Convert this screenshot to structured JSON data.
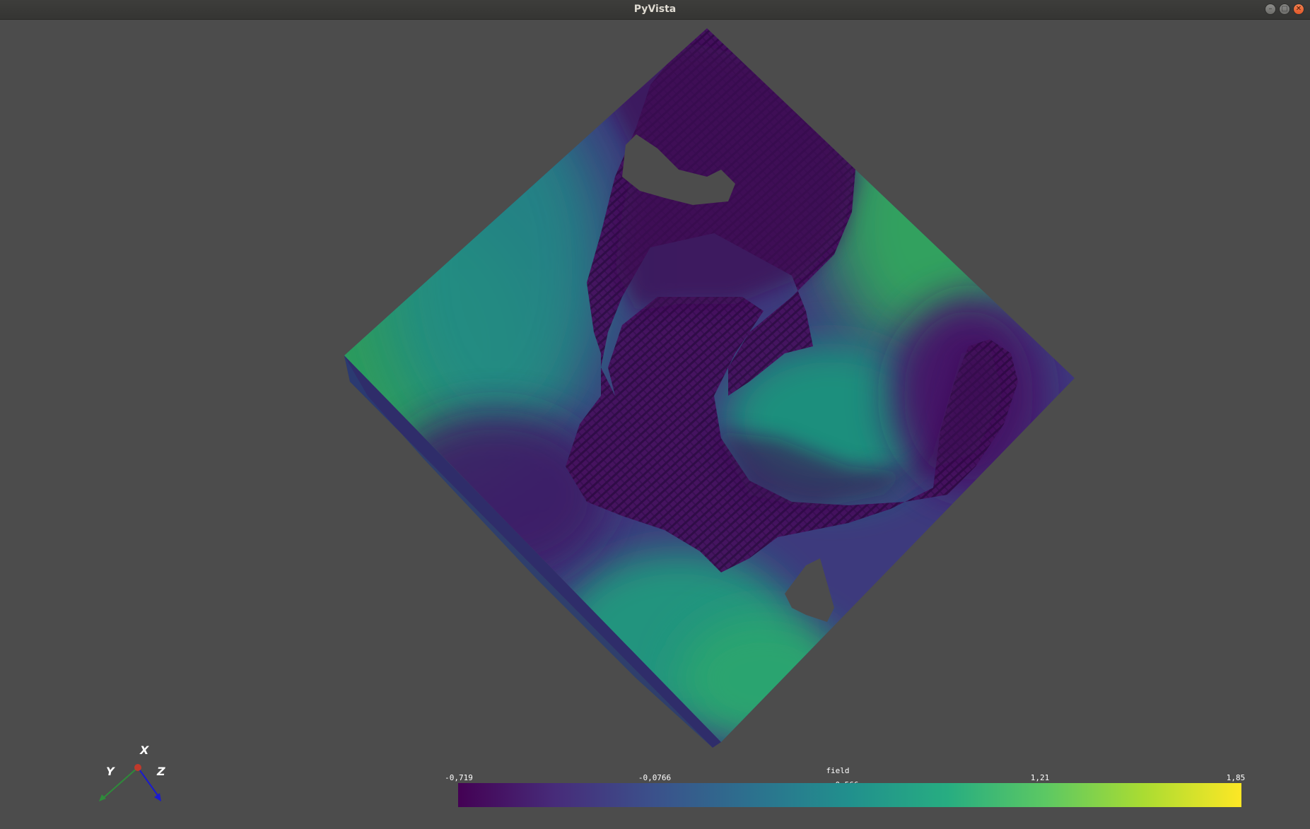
{
  "window": {
    "title": "PyVista",
    "controls": [
      "minimize",
      "maximize",
      "close"
    ]
  },
  "scene": {
    "background_color": "#4c4c4c",
    "mesh_colormap": "viridis"
  },
  "axes_widget": {
    "x_label": "X",
    "y_label": "Y",
    "z_label": "Z",
    "x_color": "#c0392b",
    "y_color": "#2e8b3a",
    "z_color": "#1a1ad0"
  },
  "colorbar": {
    "title": "field",
    "ticks": [
      "-0,719",
      "-0,0766",
      "0,566",
      "1,21",
      "1,85"
    ],
    "min": -0.719,
    "max": 1.85,
    "colors": [
      "#440154",
      "#472c7a",
      "#3b518b",
      "#2c718e",
      "#21908d",
      "#27ad81",
      "#5cc863",
      "#aadc32",
      "#fde725"
    ]
  }
}
